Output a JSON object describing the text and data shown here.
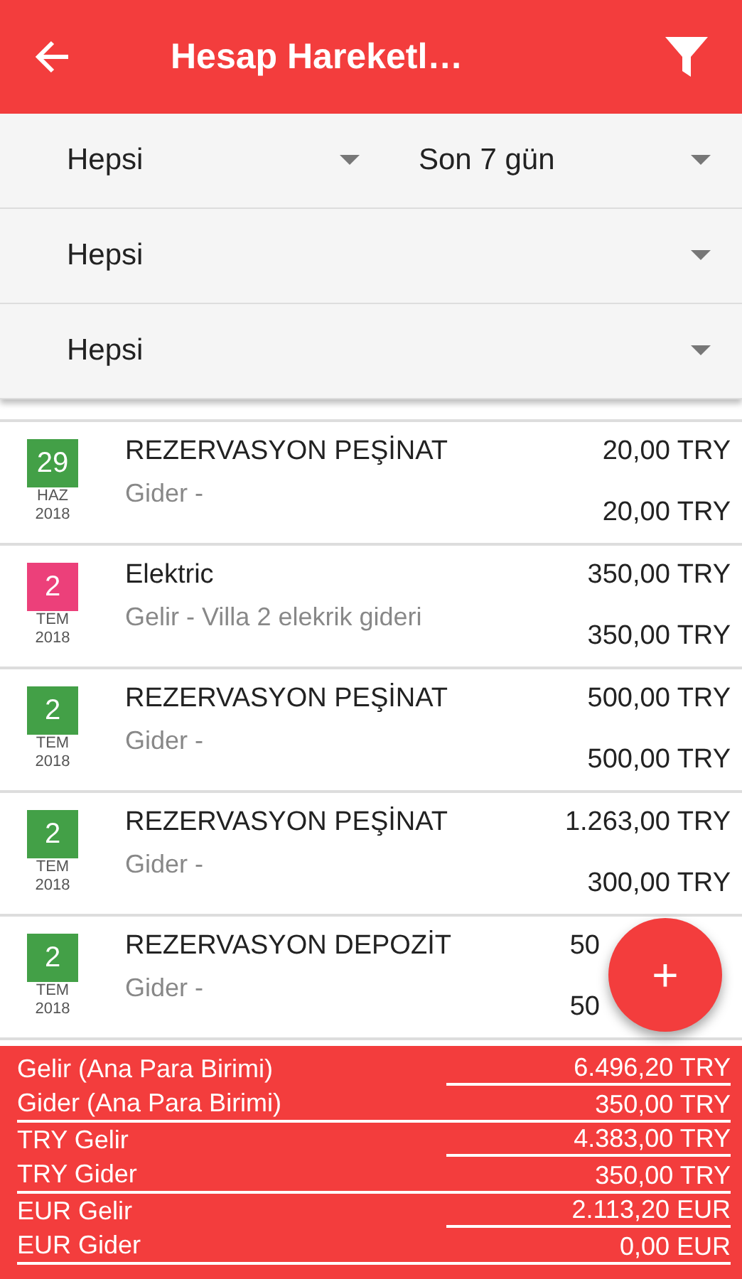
{
  "app_bar": {
    "title": "Hesap Hareketl…"
  },
  "filters": [
    [
      {
        "value": "Hepsi"
      },
      {
        "value": "Son 7 gün"
      }
    ],
    [
      {
        "value": "Hepsi"
      }
    ],
    [
      {
        "value": "Hepsi"
      }
    ]
  ],
  "transactions": [
    {
      "day": "29",
      "month": "HAZ",
      "year": "2018",
      "color": "#43a047",
      "title": "REZERVASYON PEŞİNAT",
      "subtitle": "Gider -",
      "amount": "20,00 TRY",
      "amount_2": "20,00 TRY",
      "cut": false
    },
    {
      "day": "2",
      "month": "TEM",
      "year": "2018",
      "color": "#ec407a",
      "title": "Elektric",
      "subtitle": "Gelir - Villa 2 elekrik gideri",
      "amount": "350,00 TRY",
      "amount_2": "350,00 TRY",
      "cut": false
    },
    {
      "day": "2",
      "month": "TEM",
      "year": "2018",
      "color": "#43a047",
      "title": "REZERVASYON PEŞİNAT",
      "subtitle": "Gider -",
      "amount": "500,00 TRY",
      "amount_2": "500,00 TRY",
      "cut": false
    },
    {
      "day": "2",
      "month": "TEM",
      "year": "2018",
      "color": "#43a047",
      "title": "REZERVASYON PEŞİNAT",
      "subtitle": "Gider -",
      "amount": "1.263,00 TRY",
      "amount_2": "300,00 TRY",
      "cut": false
    },
    {
      "day": "2",
      "month": "TEM",
      "year": "2018",
      "color": "#43a047",
      "title": "REZERVASYON DEPOZİT",
      "subtitle": "Gider -",
      "amount": "50",
      "amount_2": "50",
      "cut": true
    }
  ],
  "fab": {
    "label": "+"
  },
  "summary": [
    [
      {
        "label": "Gelir (Ana Para Birimi)",
        "value": "6.496,20 TRY"
      },
      {
        "label": "Gider (Ana Para Birimi)",
        "value": "350,00 TRY"
      }
    ],
    [
      {
        "label": "TRY Gelir",
        "value": "4.383,00 TRY"
      },
      {
        "label": "TRY Gider",
        "value": "350,00 TRY"
      }
    ],
    [
      {
        "label": "EUR Gelir",
        "value": "2.113,20 EUR"
      },
      {
        "label": "EUR Gider",
        "value": "0,00 EUR"
      }
    ]
  ]
}
